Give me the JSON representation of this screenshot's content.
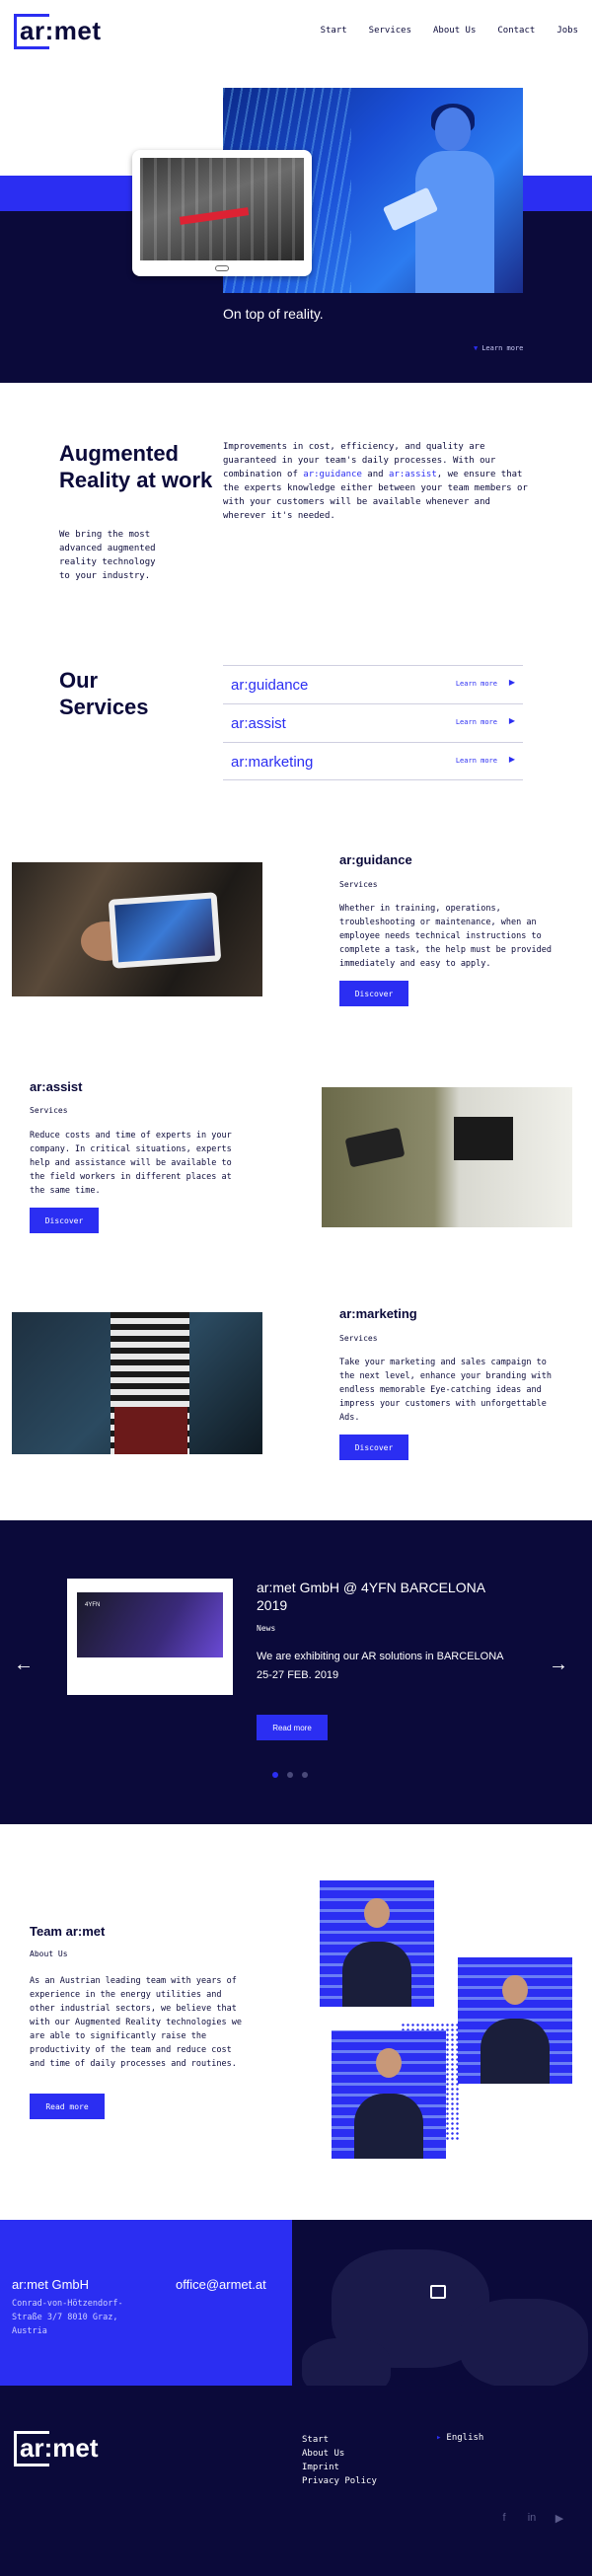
{
  "header": {
    "logo": "ar:met",
    "nav": [
      "Start",
      "Services",
      "About Us",
      "Contact",
      "Jobs"
    ]
  },
  "hero": {
    "tagline": "On top of reality.",
    "learn_more": "Learn more"
  },
  "intro": {
    "title": "Augmented Reality at work",
    "subtitle": "We bring the most advanced augmented reality technology to your industry.",
    "text_1": "Improvements in cost, efficiency, and quality are guaranteed in your team's daily processes. With our combination of ",
    "text_guidance": "ar:guidance",
    "text_and": " and ",
    "text_assist": "ar:assist",
    "text_2": ", we ensure that the experts knowledge either between your team members or with your customers will be available whenever and wherever it's needed."
  },
  "services": {
    "title": "Our Services",
    "items": [
      {
        "name": "ar:guidance",
        "link": "Learn more"
      },
      {
        "name": "ar:assist",
        "link": "Learn more"
      },
      {
        "name": "ar:marketing",
        "link": "Learn more"
      }
    ]
  },
  "features": {
    "guidance": {
      "title": "ar:guidance",
      "subtitle": "Services",
      "text": "Whether in training, operations, troubleshooting or maintenance, when an employee needs technical instructions to complete a task, the help must be provided immediately and easy to apply.",
      "button": "Discover"
    },
    "assist": {
      "title": "ar:assist",
      "subtitle": "Services",
      "text": "Reduce costs and time of experts in your company. In critical situations, experts help and assistance will be available to the field workers in different places at the same time.",
      "button": "Discover"
    },
    "marketing": {
      "title": "ar:marketing",
      "subtitle": "Services",
      "text": "Take your marketing and sales campaign to the next level, enhance your branding with endless memorable Eye-catching ideas and impress your customers with unforgettable Ads.",
      "button": "Discover"
    }
  },
  "news": {
    "title": "ar:met GmbH @ 4YFN BARCELONA 2019",
    "subtitle": "News",
    "text": "We are exhibiting our AR solutions in BARCELONA 25-27 FEB. 2019",
    "button": "Read more",
    "card_text": "4YFN"
  },
  "team": {
    "title": "Team ar:met",
    "subtitle": "About Us",
    "text": "As an Austrian leading team with years of experience in the energy utilities and other industrial sectors, we believe that with our Augmented Reality technologies we are able to significantly raise the productivity of the team and reduce cost and time of daily processes and routines.",
    "button": "Read more"
  },
  "contact": {
    "company": "ar:met GmbH",
    "email": "office@armet.at",
    "address": "Conrad-von-Hötzendorf-Straße 3/7 8010 Graz, Austria"
  },
  "footer": {
    "logo": "ar:met",
    "links": [
      "Start",
      "About Us",
      "Imprint",
      "Privacy Policy"
    ],
    "language": "English"
  },
  "colors": {
    "accent": "#2b2ef2",
    "dark": "#0b0a3a"
  }
}
